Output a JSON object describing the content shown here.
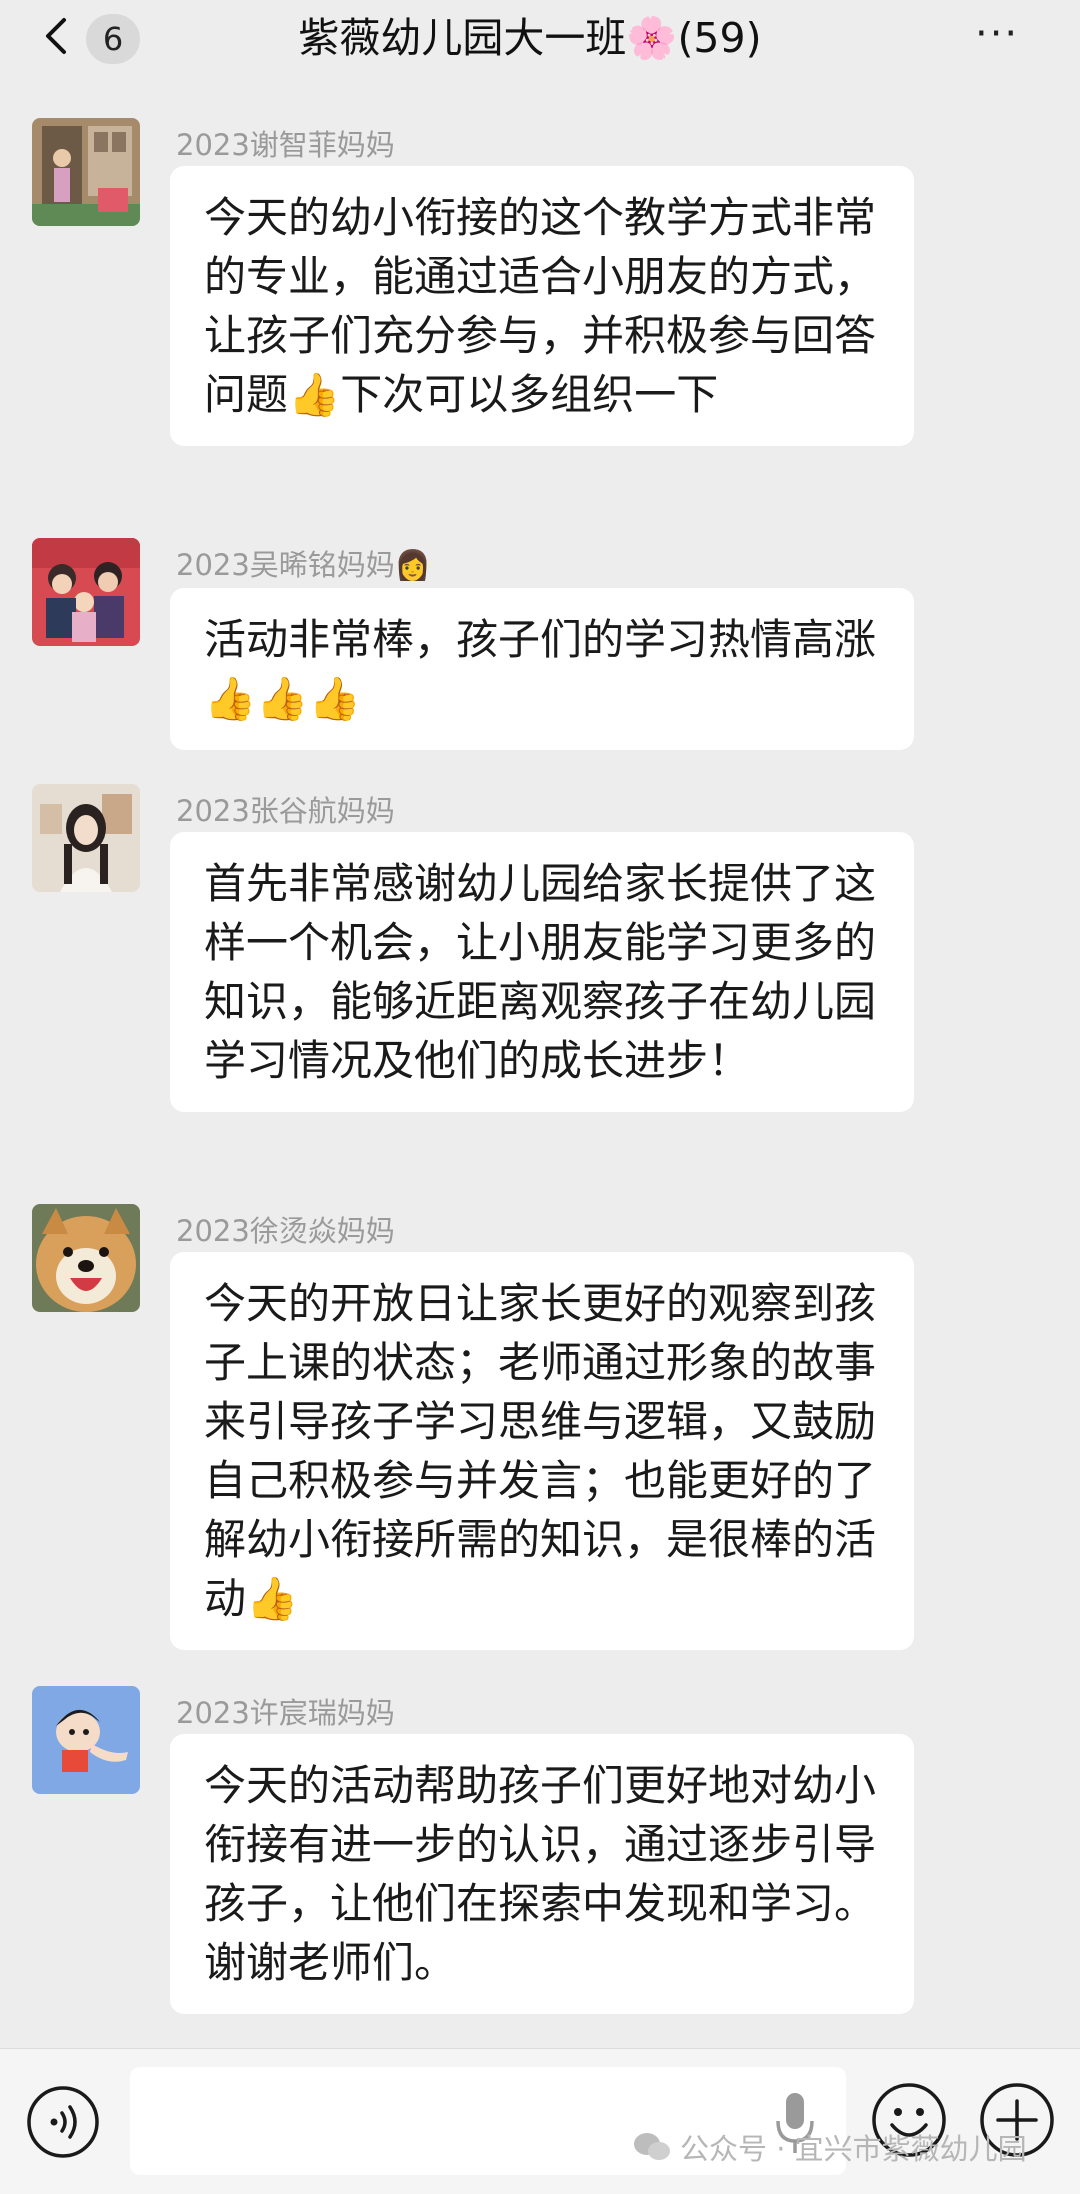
{
  "header": {
    "unread_count": "6",
    "title": "紫薇幼儿园大一班🌸(59)",
    "more_label": "···"
  },
  "messages": [
    {
      "sender": "2023谢智菲妈妈",
      "text": "今天的幼小衔接的这个教学方式非常的专业，能通过适合小朋友的方式，让孩子们充分参与，并积极参与回答问题👍下次可以多组织一下"
    },
    {
      "sender": "2023吴晞铭妈妈👩",
      "text": "活动非常棒，孩子们的学习热情高涨👍👍👍"
    },
    {
      "sender": "2023张谷航妈妈",
      "text": "首先非常感谢幼儿园给家长提供了这样一个机会，让小朋友能学习更多的知识，能够近距离观察孩子在幼儿园学习情况及他们的成长进步！"
    },
    {
      "sender": "2023徐烫焱妈妈",
      "text": "今天的开放日让家长更好的观察到孩子上课的状态；老师通过形象的故事来引导孩子学习思维与逻辑，又鼓励自己积极参与并发言；也能更好的了解幼小衔接所需的知识，是很棒的活动👍"
    },
    {
      "sender": "2023许宸瑞妈妈",
      "text": "今天的活动帮助孩子们更好地对幼小衔接有进一步的认识，通过逐步引导孩子，让他们在探索中发现和学习。谢谢老师们。"
    }
  ],
  "watermark": "公众号 · 宜兴市紫薇幼儿园",
  "icons": {
    "back": "chevron-left-icon",
    "voice": "voice-icon",
    "mic": "mic-icon",
    "emoji": "emoji-icon",
    "plus": "plus-icon",
    "watermark": "wechat-icon"
  },
  "colors": {
    "background": "#ededed",
    "bubble": "#ffffff",
    "sender_name": "#9a9a9a"
  }
}
